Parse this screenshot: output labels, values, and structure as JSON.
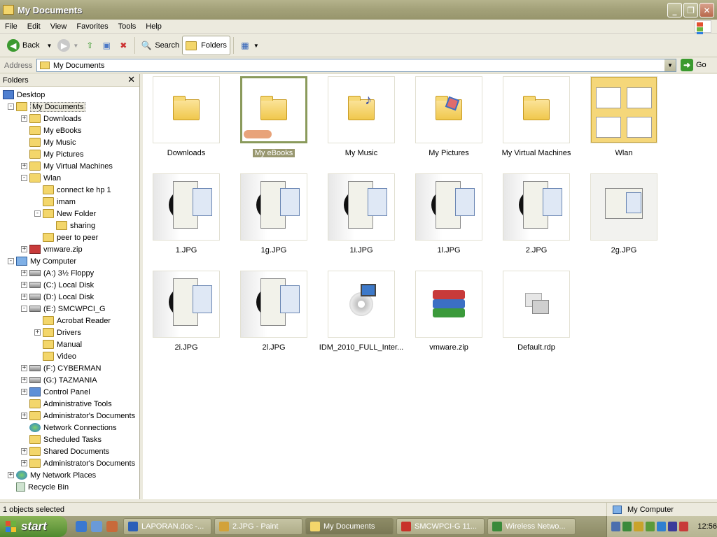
{
  "window": {
    "title": "My Documents"
  },
  "menu": [
    "File",
    "Edit",
    "View",
    "Favorites",
    "Tools",
    "Help"
  ],
  "toolbar": {
    "back": "Back",
    "search": "Search",
    "folders": "Folders"
  },
  "address": {
    "label": "Address",
    "value": "My Documents",
    "go": "Go"
  },
  "folders_pane": {
    "title": "Folders",
    "tree": [
      {
        "label": "Desktop",
        "indent": 0,
        "icon": "desktop",
        "exp": ""
      },
      {
        "label": "My Documents",
        "indent": 1,
        "icon": "folder",
        "exp": "-",
        "selected": true
      },
      {
        "label": "Downloads",
        "indent": 2,
        "icon": "folder",
        "exp": "+"
      },
      {
        "label": "My eBooks",
        "indent": 2,
        "icon": "folder",
        "exp": ""
      },
      {
        "label": "My Music",
        "indent": 2,
        "icon": "folder",
        "exp": ""
      },
      {
        "label": "My Pictures",
        "indent": 2,
        "icon": "folder",
        "exp": ""
      },
      {
        "label": "My Virtual Machines",
        "indent": 2,
        "icon": "folder",
        "exp": "+"
      },
      {
        "label": "Wlan",
        "indent": 2,
        "icon": "folder",
        "exp": "-"
      },
      {
        "label": "connect ke hp 1",
        "indent": 3,
        "icon": "folder",
        "exp": ""
      },
      {
        "label": "imam",
        "indent": 3,
        "icon": "folder",
        "exp": ""
      },
      {
        "label": "New Folder",
        "indent": 3,
        "icon": "folder",
        "exp": "-"
      },
      {
        "label": "sharing",
        "indent": 4,
        "icon": "folder",
        "exp": ""
      },
      {
        "label": "peer to peer",
        "indent": 3,
        "icon": "folder",
        "exp": ""
      },
      {
        "label": "vmware.zip",
        "indent": 2,
        "icon": "red",
        "exp": "+"
      },
      {
        "label": "My Computer",
        "indent": 1,
        "icon": "computer",
        "exp": "-"
      },
      {
        "label": "(A:) 3½ Floppy",
        "indent": 2,
        "icon": "drive",
        "exp": "+"
      },
      {
        "label": "(C:) Local Disk",
        "indent": 2,
        "icon": "drive",
        "exp": "+"
      },
      {
        "label": "(D:) Local Disk",
        "indent": 2,
        "icon": "drive",
        "exp": "+"
      },
      {
        "label": "(E:) SMCWPCI_G",
        "indent": 2,
        "icon": "drive",
        "exp": "-"
      },
      {
        "label": "Acrobat Reader",
        "indent": 3,
        "icon": "folder",
        "exp": ""
      },
      {
        "label": "Drivers",
        "indent": 3,
        "icon": "folder",
        "exp": "+"
      },
      {
        "label": "Manual",
        "indent": 3,
        "icon": "folder",
        "exp": ""
      },
      {
        "label": "Video",
        "indent": 3,
        "icon": "folder",
        "exp": ""
      },
      {
        "label": "(F:) CYBERMAN",
        "indent": 2,
        "icon": "drive",
        "exp": "+"
      },
      {
        "label": "(G:) TAZMANIA",
        "indent": 2,
        "icon": "drive",
        "exp": "+"
      },
      {
        "label": "Control Panel",
        "indent": 2,
        "icon": "cp",
        "exp": "+"
      },
      {
        "label": "Administrative Tools",
        "indent": 2,
        "icon": "folder",
        "exp": ""
      },
      {
        "label": "Administrator's Documents",
        "indent": 2,
        "icon": "folder",
        "exp": "+"
      },
      {
        "label": "Network Connections",
        "indent": 2,
        "icon": "net",
        "exp": ""
      },
      {
        "label": "Scheduled Tasks",
        "indent": 2,
        "icon": "folder",
        "exp": ""
      },
      {
        "label": "Shared Documents",
        "indent": 2,
        "icon": "folder",
        "exp": "+"
      },
      {
        "label": "Administrator's Documents",
        "indent": 2,
        "icon": "folder",
        "exp": "+"
      },
      {
        "label": "My Network Places",
        "indent": 1,
        "icon": "net",
        "exp": "+"
      },
      {
        "label": "Recycle Bin",
        "indent": 1,
        "icon": "recycle",
        "exp": ""
      }
    ]
  },
  "items": [
    {
      "name": "Downloads",
      "kind": "folder"
    },
    {
      "name": "My eBooks",
      "kind": "folder-shared",
      "selected": true
    },
    {
      "name": "My Music",
      "kind": "folder-music"
    },
    {
      "name": "My Pictures",
      "kind": "folder-pictures"
    },
    {
      "name": "My Virtual Machines",
      "kind": "folder"
    },
    {
      "name": "Wlan",
      "kind": "folder-thumbs"
    },
    {
      "name": "1.JPG",
      "kind": "screenshot"
    },
    {
      "name": "1g.JPG",
      "kind": "screenshot"
    },
    {
      "name": "1i.JPG",
      "kind": "screenshot"
    },
    {
      "name": "1l.JPG",
      "kind": "screenshot"
    },
    {
      "name": "2.JPG",
      "kind": "screenshot"
    },
    {
      "name": "2g.JPG",
      "kind": "screenshot-small"
    },
    {
      "name": "2i.JPG",
      "kind": "screenshot"
    },
    {
      "name": "2l.JPG",
      "kind": "screenshot"
    },
    {
      "name": "IDM_2010_FULL_Inter...",
      "kind": "installer"
    },
    {
      "name": "vmware.zip",
      "kind": "rar"
    },
    {
      "name": "Default.rdp",
      "kind": "rdp"
    }
  ],
  "status": {
    "selection": "1 objects selected",
    "zone": "My Computer"
  },
  "taskbar": {
    "start": "start",
    "tasks": [
      {
        "label": "LAPORAN.doc -...",
        "color": "#2b5fb8"
      },
      {
        "label": "2.JPG - Paint",
        "color": "#d2a23a"
      },
      {
        "label": "My Documents",
        "color": "#f3d66b",
        "active": true
      },
      {
        "label": "SMCWPCI-G 11...",
        "color": "#c8322a"
      },
      {
        "label": "Wireless Netwo...",
        "color": "#3a8a3a"
      }
    ],
    "clock": "12:56"
  }
}
